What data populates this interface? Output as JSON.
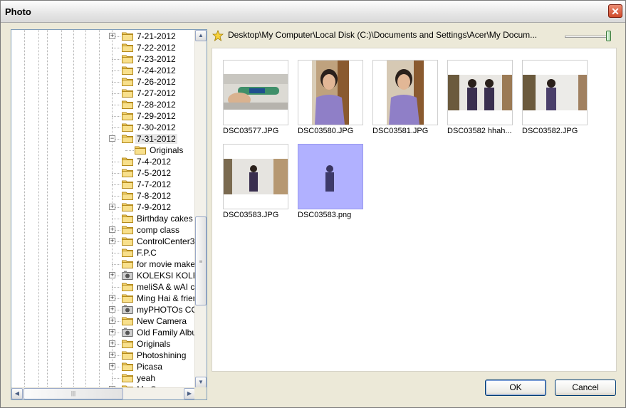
{
  "window": {
    "title": "Photo",
    "close_glyph": "✕"
  },
  "tree": {
    "top_items": [
      "7-21-2012",
      "7-22-2012",
      "7-23-2012",
      "7-24-2012",
      "7-26-2012",
      "7-27-2012",
      "7-28-2012",
      "7-29-2012",
      "7-30-2012",
      "7-31-2012"
    ],
    "selected_child": "Originals",
    "bottom_items": [
      "7-4-2012",
      "7-5-2012",
      "7-7-2012",
      "7-8-2012",
      "7-9-2012",
      "Birthday cakes",
      "comp class",
      "ControlCenter3",
      "F.P.C",
      "for movie make",
      "KOLEKSI KOLEK",
      "meliSA & wAI c",
      "Ming Hai & frier",
      "myPHOTOs CO",
      "New Camera",
      "Old Family Albu",
      "Originals",
      "Photoshining",
      "Picasa",
      "yeah"
    ],
    "last_item": "My Scans"
  },
  "pathbar": {
    "icon": "star-icon",
    "path": "Desktop\\My Computer\\Local Disk (C:)\\Documents and Settings\\Acer\\My Docum..."
  },
  "photos": [
    {
      "caption": "DSC03577.JPG"
    },
    {
      "caption": "DSC03580.JPG"
    },
    {
      "caption": "DSC03581.JPG"
    },
    {
      "caption": "DSC03582 hhah..."
    },
    {
      "caption": "DSC03582.JPG"
    },
    {
      "caption": "DSC03583.JPG"
    },
    {
      "caption": "DSC03583.png"
    }
  ],
  "buttons": {
    "ok": "OK",
    "cancel": "Cancel"
  },
  "colors": {
    "selection": "#b1b1ff",
    "folder": "#f4d36b",
    "border": "#7f9db9"
  }
}
